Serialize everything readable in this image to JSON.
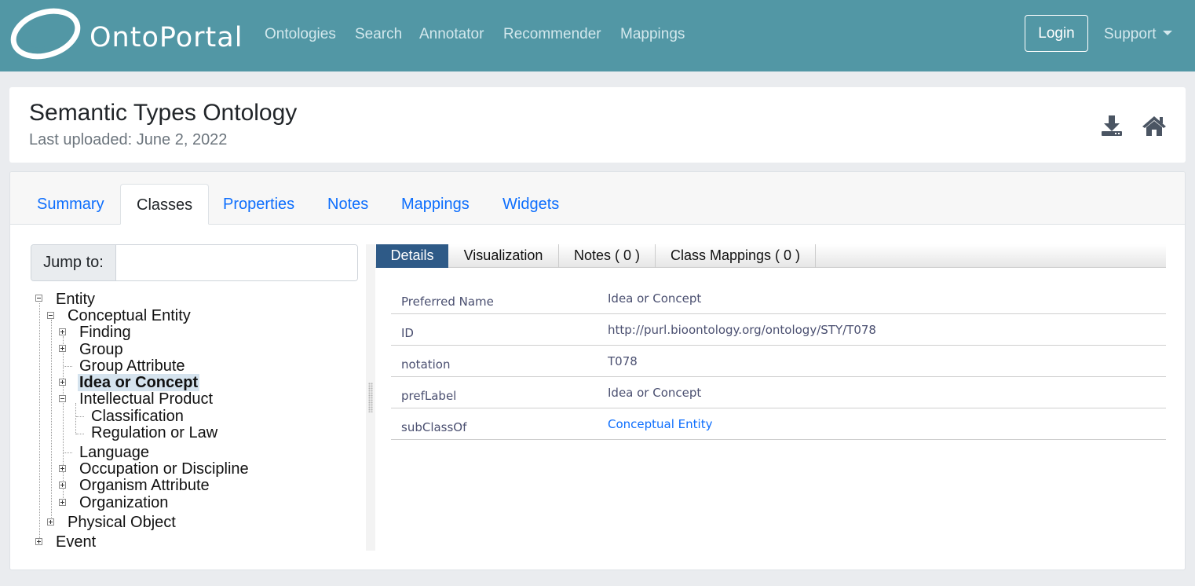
{
  "navbar": {
    "brand": "OntoPortal",
    "links": [
      "Ontologies",
      "Search",
      "Annotator",
      "Recommender",
      "Mappings"
    ],
    "login_label": "Login",
    "support_label": "Support"
  },
  "header": {
    "title": "Semantic Types Ontology",
    "last_uploaded": "Last uploaded: June 2, 2022",
    "icons": [
      "download-icon",
      "home-icon"
    ]
  },
  "tabs": [
    "Summary",
    "Classes",
    "Properties",
    "Notes",
    "Mappings",
    "Widgets"
  ],
  "active_tab": "Classes",
  "jump": {
    "label": "Jump to:",
    "value": ""
  },
  "tree": {
    "entity": "Entity",
    "conceptual_entity": "Conceptual Entity",
    "finding": "Finding",
    "group": "Group",
    "group_attribute": "Group Attribute",
    "idea_or_concept": "Idea or Concept",
    "intellectual_product": "Intellectual Product",
    "classification": "Classification",
    "regulation_or_law": "Regulation or Law",
    "language": "Language",
    "occupation_or_discipline": "Occupation or Discipline",
    "organism_attribute": "Organism Attribute",
    "organization": "Organization",
    "physical_object": "Physical Object",
    "event": "Event",
    "selected": "Idea or Concept"
  },
  "detail_tabs": [
    "Details",
    "Visualization",
    "Notes ( 0 )",
    "Class Mappings ( 0 )"
  ],
  "active_detail_tab": "Details",
  "details": [
    {
      "key": "Preferred Name",
      "value": "Idea or Concept"
    },
    {
      "key": "ID",
      "value": "http://purl.bioontology.org/ontology/STY/T078"
    },
    {
      "key": "notation",
      "value": "T078"
    },
    {
      "key": "prefLabel",
      "value": "Idea or Concept"
    },
    {
      "key": "subClassOf",
      "value": "Conceptual Entity"
    }
  ],
  "colors": {
    "navbar": "#5297a5",
    "link": "#0d6efd",
    "active_detail_tab": "#2e5a87",
    "selected_node": "#d5e3ee"
  }
}
